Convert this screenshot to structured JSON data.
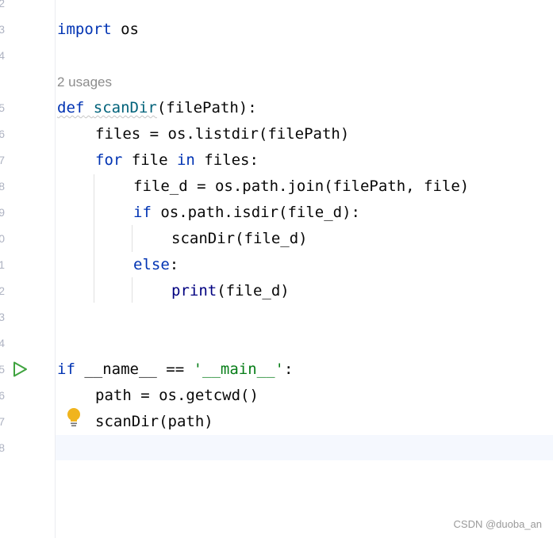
{
  "editor": {
    "line_numbers": [
      "2",
      "3",
      "4",
      "5",
      "6",
      "7",
      "8",
      "9",
      "0",
      "1",
      "2",
      "3",
      "4",
      "5",
      "6",
      "7",
      "8"
    ],
    "inlay_usages": "2 usages",
    "lines": {
      "l3": {
        "kw": "import",
        "rest": " os"
      },
      "l5": {
        "kw": "def",
        "fn": "scanDir",
        "rest": "(filePath):"
      },
      "l6": {
        "text": "files = os.listdir(filePath)"
      },
      "l7": {
        "kw1": "for",
        "mid": " file ",
        "kw2": "in",
        "rest": " files:"
      },
      "l8": {
        "text": "file_d = os.path.join(filePath, file)"
      },
      "l9": {
        "kw": "if",
        "rest": " os.path.isdir(file_d):"
      },
      "l10": {
        "text": "scanDir(file_d)"
      },
      "l11": {
        "kw": "else",
        "rest": ":"
      },
      "l12": {
        "bi": "print",
        "rest": "(file_d)"
      },
      "l15": {
        "kw": "if",
        "mid": " __name__ == ",
        "str": "'__main__'",
        "rest": ":"
      },
      "l16": {
        "text": "path = os.getcwd()"
      },
      "l17": {
        "text": "scanDir(path)"
      }
    }
  },
  "icons": {
    "run": "run-triangle-icon",
    "bulb": "lightbulb-icon"
  },
  "colors": {
    "keyword": "#0033b3",
    "function": "#00627a",
    "string": "#067d17",
    "builtin": "#000080",
    "run": "#3fa33f",
    "bulb": "#f0b41e"
  },
  "watermark": "CSDN @duoba_an"
}
